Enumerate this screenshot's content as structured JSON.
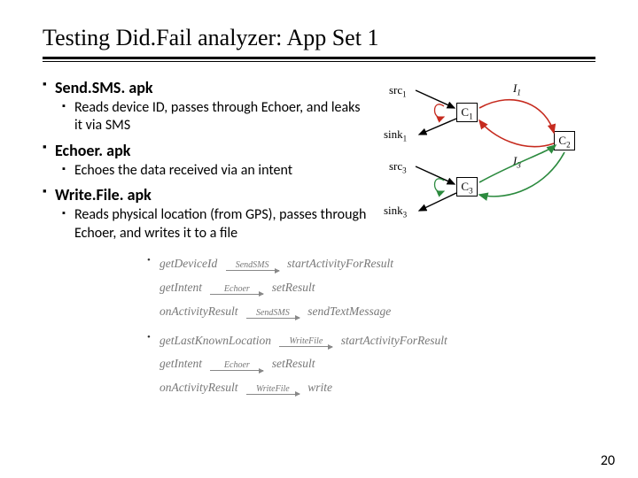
{
  "title": "Testing Did.Fail analyzer: App Set 1",
  "bullets": [
    {
      "apk": "Send.SMS. apk",
      "desc": "Reads device ID, passes through Echoer, and leaks it via SMS"
    },
    {
      "apk": "Echoer. apk",
      "desc": "Echoes the data received via an intent"
    },
    {
      "apk": "Write.File. apk",
      "desc": "Reads physical location (from GPS), passes through Echoer, and writes it to a file"
    }
  ],
  "diagram": {
    "labels": {
      "src1": "src",
      "src1_sub": "1",
      "sink1": "sink",
      "sink1_sub": "1",
      "src3": "src",
      "src3_sub": "3",
      "sink3": "sink",
      "sink3_sub": "3",
      "I1": "I",
      "I1_sub": "1",
      "I3": "I",
      "I3_sub": "3",
      "C1": "C",
      "C1_sub": "1",
      "C2": "C",
      "C2_sub": "2",
      "C3": "C",
      "C3_sub": "3"
    }
  },
  "formulas": {
    "block1": [
      {
        "dot": true,
        "lhs": "getDeviceId",
        "tag": "SendSMS",
        "rhs": "startActivityForResult"
      },
      {
        "dot": false,
        "lhs": "getIntent",
        "tag": "Echoer",
        "rhs": "setResult"
      },
      {
        "dot": false,
        "lhs": "onActivityResult",
        "tag": "SendSMS",
        "rhs": "sendTextMessage"
      }
    ],
    "block2": [
      {
        "dot": true,
        "lhs": "getLastKnownLocation",
        "tag": "WriteFile",
        "rhs": "startActivityForResult"
      },
      {
        "dot": false,
        "lhs": "getIntent",
        "tag": "Echoer",
        "rhs": "setResult"
      },
      {
        "dot": false,
        "lhs": "onActivityResult",
        "tag": "WriteFile",
        "rhs": "write"
      }
    ]
  },
  "pagenum": "20"
}
